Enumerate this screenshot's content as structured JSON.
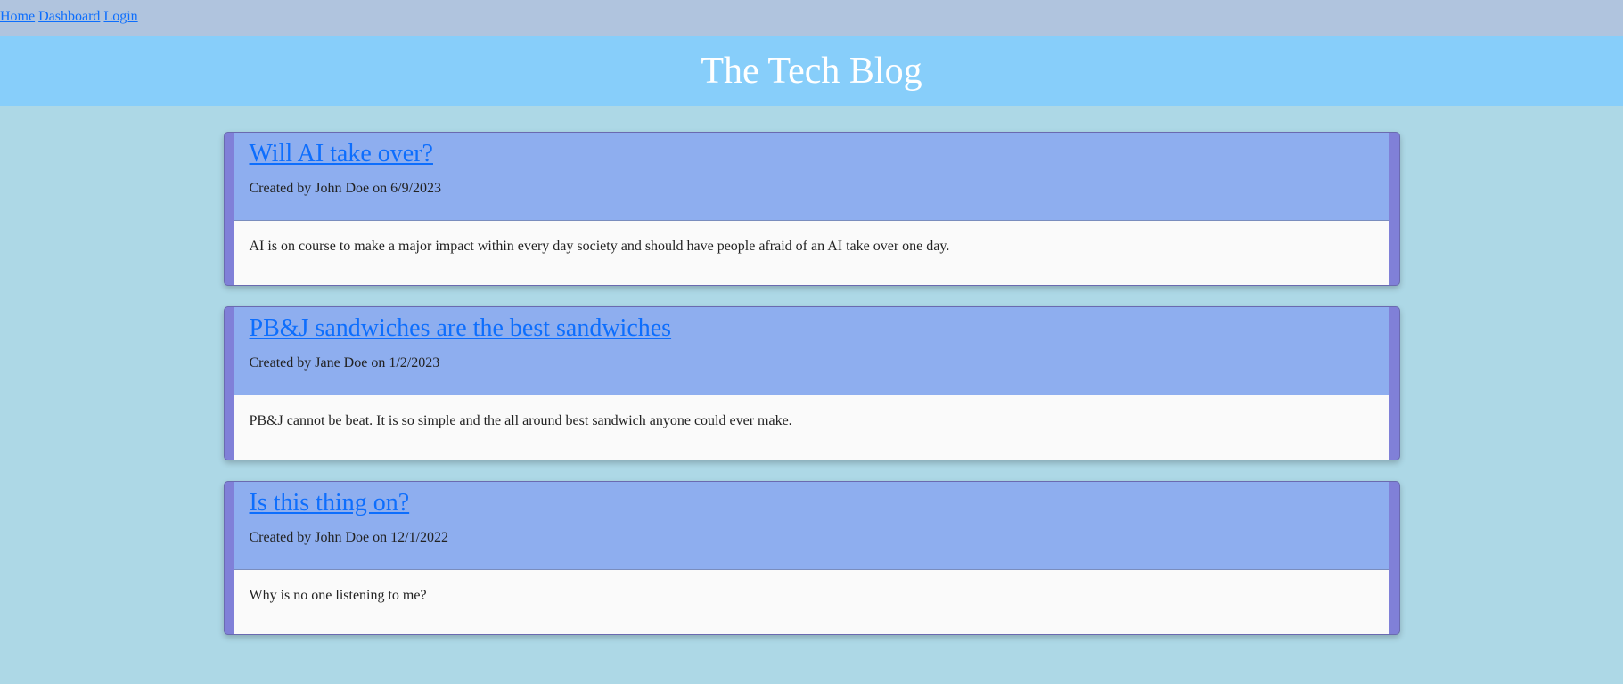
{
  "nav": {
    "items": [
      {
        "label": "Home"
      },
      {
        "label": "Dashboard"
      },
      {
        "label": "Login"
      }
    ]
  },
  "header": {
    "title": "The Tech Blog"
  },
  "posts": [
    {
      "title": "Will AI take over?",
      "meta": "Created by John Doe on 6/9/2023",
      "body": "AI is on course to make a major impact within every day society and should have people afraid of an AI take over one day."
    },
    {
      "title": "PB&J sandwiches are the best sandwiches",
      "meta": "Created by Jane Doe on 1/2/2023",
      "body": "PB&J cannot be beat. It is so simple and the all around best sandwich anyone could ever make."
    },
    {
      "title": "Is this thing on?",
      "meta": "Created by John Doe on 12/1/2022",
      "body": "Why is no one listening to me?"
    }
  ],
  "colors": {
    "page_background": "#add8e6",
    "nav_background": "#b0c4de",
    "header_background": "#87cefa",
    "post_frame": "#8080d8",
    "post_header": "#8eaeef",
    "post_body": "#fafafa",
    "link": "#0d6efd"
  }
}
